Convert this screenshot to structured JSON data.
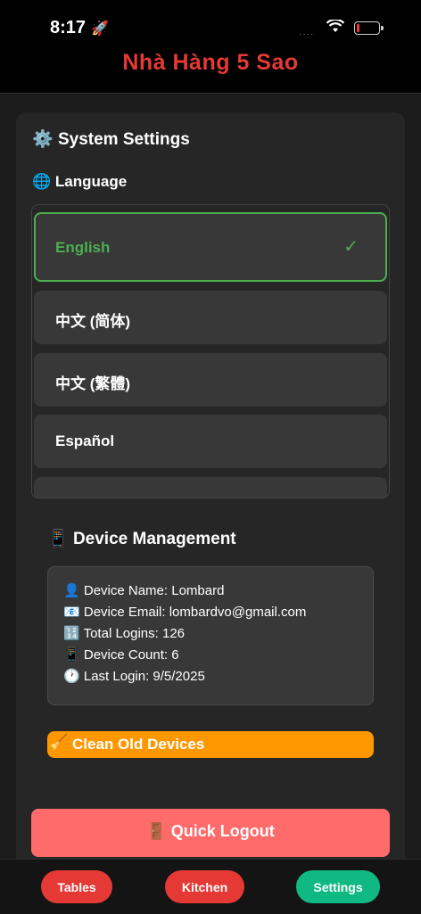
{
  "status_bar": {
    "time": "8:17",
    "signal_glyph": "····"
  },
  "header": {
    "title": "Nhà Hàng 5 Sao"
  },
  "settings": {
    "title": "System Settings",
    "language_title": "Language",
    "languages": [
      {
        "label": "English",
        "selected": true
      },
      {
        "label": "中文 (简体)",
        "selected": false
      },
      {
        "label": "中文 (繁體)",
        "selected": false
      },
      {
        "label": "Español",
        "selected": false
      }
    ]
  },
  "device": {
    "title": "Device Management",
    "lines": [
      "Device Name: Lombard",
      "Device Email: lombardvo@gmail.com",
      "Total Logins: 126",
      "Device Count: 6",
      "Last Login: 9/5/2025"
    ],
    "clean_label": "Clean Old Devices"
  },
  "logout": {
    "label": "Quick Logout"
  },
  "tabs": [
    {
      "label": "Tables",
      "color": "#e53935"
    },
    {
      "label": "Kitchen",
      "color": "#e53935"
    },
    {
      "label": "Settings",
      "color": "#10b981"
    }
  ],
  "colors": {
    "accent_red": "#e53935",
    "selected_green": "#4caf50",
    "warning_orange": "#ff9800",
    "logout_red": "#ff6b6b"
  }
}
